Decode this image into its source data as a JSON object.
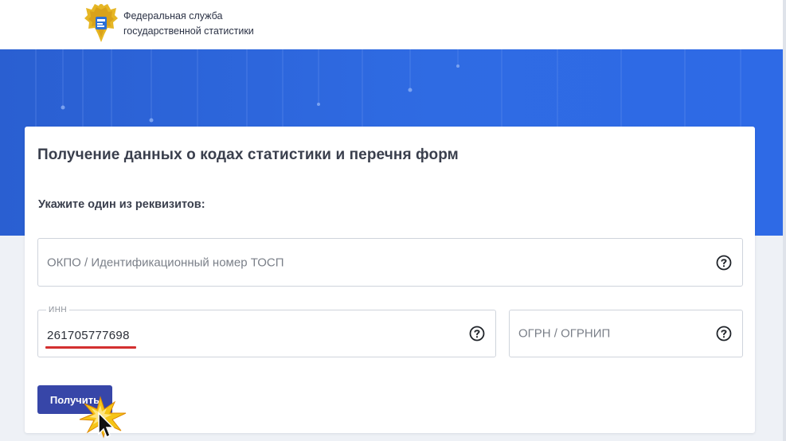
{
  "header": {
    "org_name_line1": "Федеральная служба",
    "org_name_line2": "государственной статистики",
    "logo_icon": "rosstat-eagle-emblem-icon"
  },
  "form": {
    "title": "Получение данных о кодах статистики и перечня форм",
    "subtitle": "Укажите один из реквизитов:",
    "okpo": {
      "placeholder": "ОКПО / Идентификационный номер ТОСП",
      "value": ""
    },
    "inn": {
      "label": "ИНН",
      "value": "261705777698"
    },
    "ogrn": {
      "placeholder": "ОГРН / ОГРНИП",
      "value": ""
    },
    "help_icon": "question-circle-icon",
    "submit_label": "Получить"
  },
  "colors": {
    "hero_blue": "#2f6be3",
    "button": "#3746a8",
    "annotation_underline": "#d32f2f",
    "cursor_highlight": "#f5c518"
  }
}
